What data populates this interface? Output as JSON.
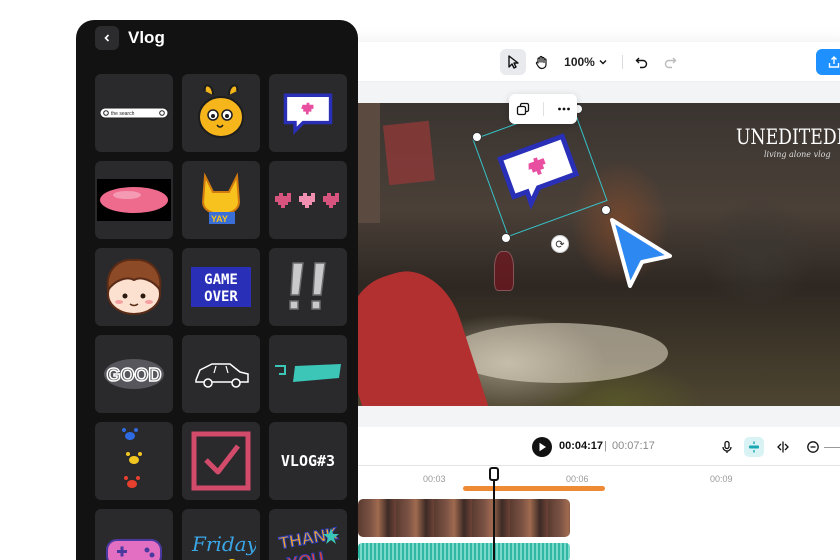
{
  "panel": {
    "title": "Vlog",
    "back_icon": "chevron-left-icon",
    "stickers": [
      {
        "name": "search-bar-sticker",
        "text": "the search"
      },
      {
        "name": "yellow-bunny-sticker"
      },
      {
        "name": "pixel-heart-speech-bubble-sticker"
      },
      {
        "name": "pink-blob-sticker"
      },
      {
        "name": "yellow-cat-sticker"
      },
      {
        "name": "pixel-hearts-row-sticker"
      },
      {
        "name": "brown-hair-kid-sticker"
      },
      {
        "name": "game-over-sticker",
        "text": "GAME OVER"
      },
      {
        "name": "exclamation-marks-sticker",
        "text": "!!"
      },
      {
        "name": "good-cloud-sticker",
        "text": "GOOD"
      },
      {
        "name": "doodle-car-sticker"
      },
      {
        "name": "teal-tape-sticker"
      },
      {
        "name": "paw-prints-sticker"
      },
      {
        "name": "checkbox-sticker"
      },
      {
        "name": "vlog3-sticker",
        "text": "VLOG#3"
      },
      {
        "name": "pink-gamepad-sticker"
      },
      {
        "name": "friday-sticker",
        "text": "Friday"
      },
      {
        "name": "thank-you-sticker",
        "text": "THANK YOU"
      }
    ]
  },
  "toolbar": {
    "zoom": "100%",
    "icons": [
      "select-pointer-icon",
      "hand-icon",
      "undo-icon",
      "redo-icon",
      "export-icon"
    ]
  },
  "canvas": {
    "overlay_title": "UNEDITEDDAY",
    "overlay_subtitle": "living alone vlog",
    "selection_menu_icons": [
      "duplicate-icon",
      "more-icon"
    ]
  },
  "timeline": {
    "current_time": "00:04:17",
    "total_time": "00:07:17",
    "ruler": [
      "00:03",
      "00:06",
      "00:09"
    ],
    "icons": [
      "microphone-icon",
      "magnet-icon",
      "split-icon",
      "zoom-out-icon"
    ]
  },
  "colors": {
    "accent": "#1e90ff",
    "selection": "#36c2c9",
    "timeline_marker": "#ef8a34",
    "panel_bg": "#121212",
    "cell_bg": "#2a2a2c"
  }
}
